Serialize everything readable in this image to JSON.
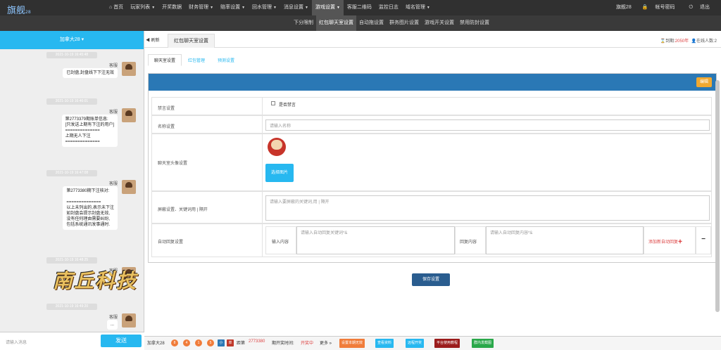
{
  "app": {
    "logo": "旗舰",
    "logo_sub": "28"
  },
  "nav": {
    "items": [
      {
        "label": "首页",
        "caret": false,
        "active": false
      },
      {
        "label": "玩家列表",
        "caret": true,
        "active": false
      },
      {
        "label": "开奖数据",
        "caret": false,
        "active": false
      },
      {
        "label": "财务管理",
        "caret": true,
        "active": false
      },
      {
        "label": "赔率设置",
        "caret": true,
        "active": false
      },
      {
        "label": "回水管理",
        "caret": true,
        "active": false
      },
      {
        "label": "消息设置",
        "caret": true,
        "active": false
      },
      {
        "label": "游戏设置",
        "caret": true,
        "active": true
      },
      {
        "label": "客服二维码",
        "caret": false,
        "active": false
      },
      {
        "label": "监控日志",
        "caret": false,
        "active": false
      },
      {
        "label": "域名管理",
        "caret": true,
        "active": false
      }
    ],
    "right": {
      "site": "旗舰28",
      "password": "帐号密码",
      "logout": "退出"
    }
  },
  "subnav": {
    "items": [
      {
        "label": "下分限制",
        "active": false
      },
      {
        "label": "红包聊天室设置",
        "active": true
      },
      {
        "label": "自动拖设置",
        "active": false
      },
      {
        "label": "群务图片设置",
        "active": false
      },
      {
        "label": "游戏开关设置",
        "active": false
      },
      {
        "label": "禁用防封设置",
        "active": false
      }
    ]
  },
  "left": {
    "header": "加拿大28",
    "messages": [
      {
        "time": "2021-10-19 16:45:48",
        "name": "客服",
        "text": "已封盘,封盘线下下注无效"
      },
      {
        "time": "2021-10-19 16:46:01",
        "name": "客服",
        "text": "第2773379期账单信息:\n[只发送上期有下注的用户]\n==============\n上期无人下注\n=============="
      },
      {
        "time": "2021-10-19 16:47:08",
        "name": "客服",
        "text": "第2773380期下注核对:\n\n==============\n以上未列出的,表示未下注\n如封盘会提示封盘无效,\n没有任何理由需要纠纷,\n包括系统通讯发事通时."
      },
      {
        "time": "2021-10-19 16:48:25",
        "name": "客服",
        "text": ""
      },
      {
        "time": "2021-10-19 16:49:20",
        "name": "客服",
        "text": "..."
      }
    ],
    "brand_text": "南丘科技",
    "input_placeholder": "请输入消息",
    "send": "发送"
  },
  "tabs": {
    "back": "◀ 刷新",
    "current": "红包聊天室设置",
    "expire_label": "到期:",
    "expire_value": "2050年",
    "online": "在线人数:2"
  },
  "inner_tabs": [
    {
      "label": "聊天室设置",
      "active": true
    },
    {
      "label": "红包管理",
      "active": false
    },
    {
      "label": "预测设置",
      "active": false
    }
  ],
  "form": {
    "edit": "编辑",
    "close_label": "禁言设置",
    "close_checkbox": "是否禁言",
    "name_label": "名称设置",
    "name_placeholder": "请输入名称",
    "avatar_label": "聊天室头像设置",
    "pick_image": "选择图片",
    "block_label": "屏蔽设置、关键词用 | 隔开",
    "block_placeholder": "请输入要屏蔽的关键词,用 | 隔开",
    "auto_label": "自动回复设置",
    "input_content": "输入内容",
    "input_placeholder": "请输入自动回复关键词*&",
    "reply_content": "回复内容",
    "reply_placeholder": "请输入自动回复内容*&",
    "add_reply": "添加新自动回复✚",
    "minus": "−",
    "save": "保存设置"
  },
  "bottom": {
    "game": "加拿大28",
    "balls": [
      "8",
      "4",
      "1",
      "5"
    ],
    "tag": "小",
    "tag2": "单",
    "period_prefix": "距第",
    "period": "2773380",
    "period_suffix": "期开奖时间:",
    "status": "开奖中",
    "more": "更多 »",
    "buttons": [
      {
        "label": "设置本期无效",
        "color": "#f07c3a"
      },
      {
        "label": "查看资料",
        "color": "#27b8f0"
      },
      {
        "label": "远程开奖",
        "color": "#27b8f0"
      },
      {
        "label": "平台使用教程",
        "color": "#9b1c1c"
      },
      {
        "label": "群内发截图",
        "color": "#2aa84a"
      }
    ]
  },
  "colors": {
    "accent": "#27b8f0",
    "panel_head": "#2a78b5",
    "topbar": "#303030"
  }
}
